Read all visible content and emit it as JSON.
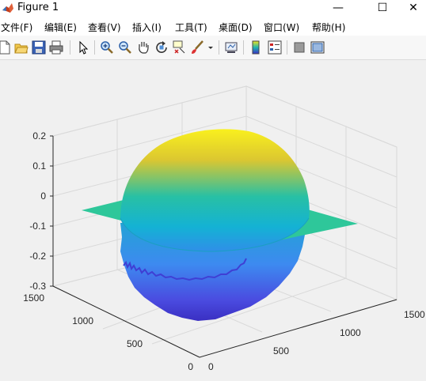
{
  "window": {
    "title": "Figure 1"
  },
  "titlebar_buttons": {
    "minimize": "—",
    "maximize": "☐",
    "close": "✕"
  },
  "menu": [
    {
      "label": "文件(F)"
    },
    {
      "label": "编辑(E)"
    },
    {
      "label": "查看(V)"
    },
    {
      "label": "插入(I)"
    },
    {
      "label": "工具(T)"
    },
    {
      "label": "桌面(D)"
    },
    {
      "label": "窗口(W)"
    },
    {
      "label": "帮助(H)"
    }
  ],
  "toolbar": {
    "icons": [
      "new-figure-icon",
      "open-file-icon",
      "save-icon",
      "print-icon",
      "edit-plot-arrow-icon",
      "zoom-in-icon",
      "zoom-out-icon",
      "pan-hand-icon",
      "rotate-3d-icon",
      "data-cursor-icon",
      "brush-icon",
      "link-plot-icon",
      "colorbar-icon",
      "legend-icon",
      "hide-plot-tools-icon",
      "show-plot-tools-icon"
    ]
  },
  "chart_data": {
    "type": "surface",
    "title": "",
    "xlabel": "",
    "ylabel": "",
    "zlabel": "",
    "z_ticks": [
      "0.2",
      "0.1",
      "0",
      "-0.1",
      "-0.2",
      "-0.3"
    ],
    "y_ticks": [
      "1500",
      "1000",
      "500",
      "0"
    ],
    "x_ticks": [
      "0",
      "500",
      "1000",
      "1500"
    ],
    "zlim": [
      -0.3,
      0.2
    ],
    "xlim": [
      0,
      1500
    ],
    "ylim": [
      0,
      1500
    ],
    "grid": true,
    "colormap": "parula",
    "description_shape": "hemisphere cap (positive) above a flat plane at z≈-0.1 with a noisy bowl (negative) below"
  },
  "colors": {
    "plane": "#2dc597",
    "cap_top": "#f2e41c",
    "cap_mid": "#1fb6b0",
    "bowl_bottom": "#4a3fd6"
  }
}
